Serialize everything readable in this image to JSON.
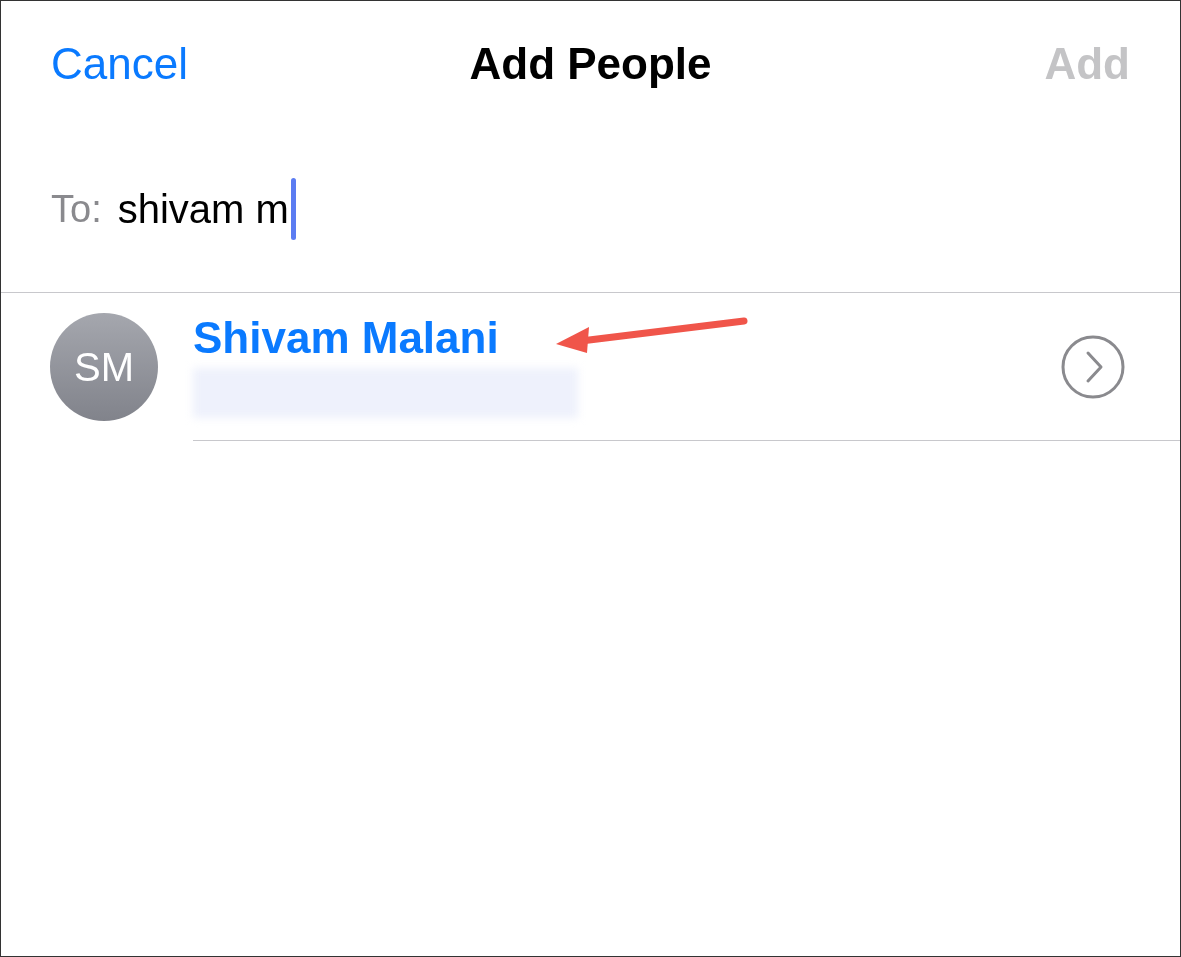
{
  "nav": {
    "cancel": "Cancel",
    "title": "Add People",
    "add": {
      "label": "Add",
      "disabled": true
    }
  },
  "to_field": {
    "label": "To:",
    "value": "shivam m"
  },
  "contacts": [
    {
      "initials": "SM",
      "name": "Shivam Malani"
    }
  ]
}
